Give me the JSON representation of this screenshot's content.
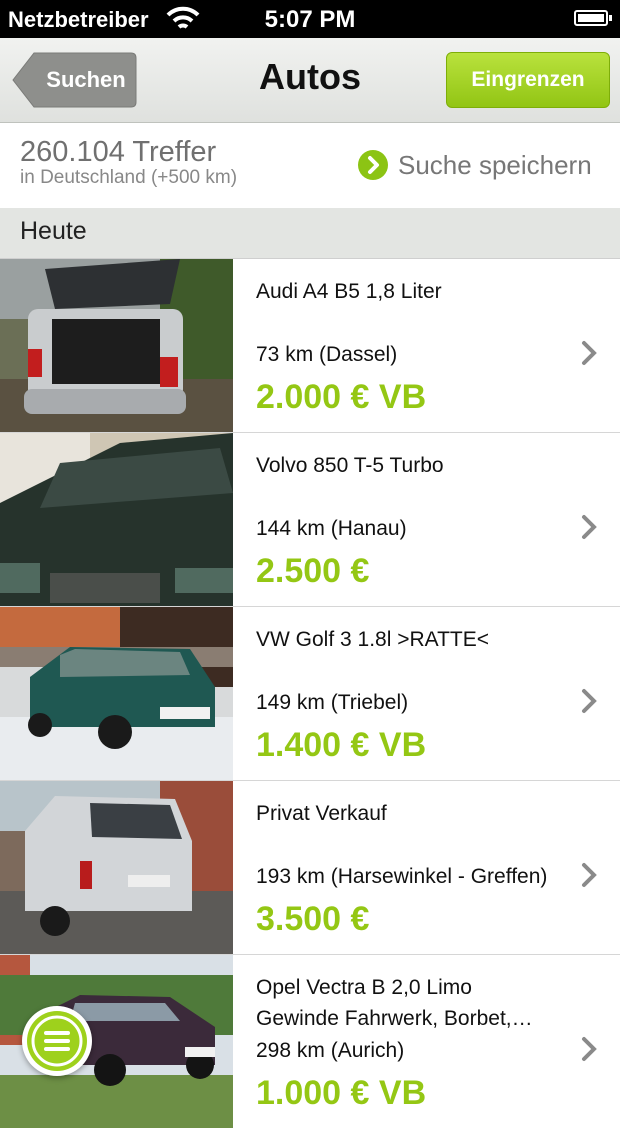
{
  "status_bar": {
    "carrier": "Netzbetreiber",
    "time": "5:07 PM"
  },
  "nav": {
    "back_label": "Suchen",
    "title": "Autos",
    "filter_label": "Eingrenzen"
  },
  "summary": {
    "hits": "260.104 Treffer",
    "region": "in Deutschland (+500 km)",
    "save_search": "Suche speichern"
  },
  "section": {
    "label": "Heute"
  },
  "listings": [
    {
      "title": "Audi A4 B5 1,8 Liter",
      "title2": "",
      "distance": "73 km (Dassel)",
      "price": "2.000 € VB"
    },
    {
      "title": "Volvo 850 T-5 Turbo",
      "title2": "",
      "distance": "144 km (Hanau)",
      "price": "2.500 €"
    },
    {
      "title": "VW Golf 3 1.8l >RATTE<",
      "title2": "",
      "distance": "149 km (Triebel)",
      "price": "1.400 € VB"
    },
    {
      "title": "Privat Verkauf",
      "title2": "",
      "distance": "193 km (Harsewinkel - Greffen)",
      "price": "3.500 €"
    },
    {
      "title": "Opel Vectra B 2,0 Limo",
      "title2": "Gewinde Fahrwerk, Borbet,…",
      "distance": "298 km (Aurich)",
      "price": "1.000 € VB"
    }
  ],
  "colors": {
    "accent": "#94c714",
    "nav_back": "#8e8f8c"
  },
  "icons": {
    "wifi": "wifi-icon",
    "battery": "battery-icon",
    "save": "chevron-circle-icon",
    "row": "chevron-right-icon",
    "menu": "menu-icon"
  }
}
